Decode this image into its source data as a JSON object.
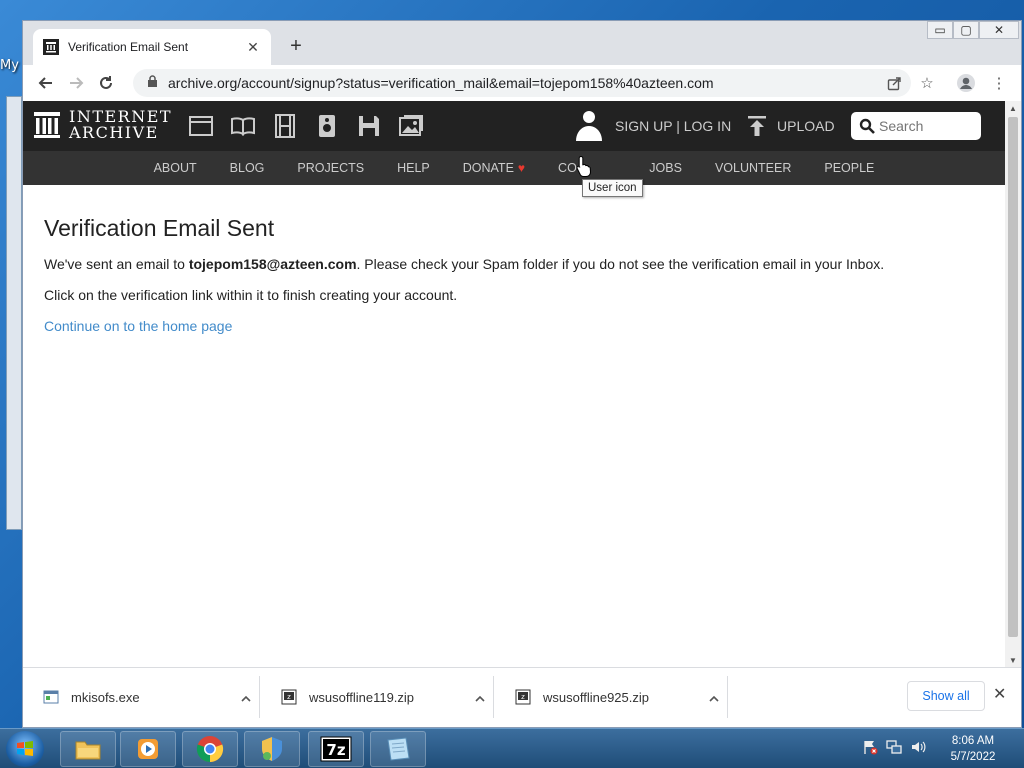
{
  "desktop": {
    "icon_label": "My"
  },
  "browser": {
    "tab_title": "Verification Email Sent",
    "url": "archive.org/account/signup?status=verification_mail&email=tojepom158%40azteen.com"
  },
  "ia_header": {
    "logo_line1": "INTERNET",
    "logo_line2": "ARCHIVE",
    "signup_login": "SIGN UP | LOG IN",
    "upload": "UPLOAD",
    "search_placeholder": "Search",
    "nav": [
      "ABOUT",
      "BLOG",
      "PROJECTS",
      "HELP",
      "DONATE",
      "CO",
      "JOBS",
      "VOLUNTEER",
      "PEOPLE"
    ],
    "tooltip": "User icon"
  },
  "page": {
    "heading": "Verification Email Sent",
    "line1_prefix": "We've sent an email to ",
    "email": "tojepom158@azteen.com",
    "line1_suffix": ". Please check your Spam folder if you do not see the verification email in your Inbox.",
    "line2": "Click on the verification link within it to finish creating your account.",
    "home_link": "Continue on to the home page"
  },
  "downloads": {
    "items": [
      {
        "name": "mkisofs.exe",
        "icon": "exe-file-icon"
      },
      {
        "name": "wsusoffline119.zip",
        "icon": "7z-archive-icon"
      },
      {
        "name": "wsusoffline925.zip",
        "icon": "7z-archive-icon"
      }
    ],
    "show_all": "Show all"
  },
  "taskbar": {
    "time": "8:06 AM",
    "date": "5/7/2022",
    "apps": [
      "file-explorer-icon",
      "media-player-icon",
      "chrome-icon",
      "security-shield-icon",
      "7zip-icon",
      "notepad-icon"
    ]
  },
  "colors": {
    "ia_dark": "#222222",
    "ia_nav": "#333333",
    "link": "#428bca",
    "donate_heart": "#e8392f"
  }
}
